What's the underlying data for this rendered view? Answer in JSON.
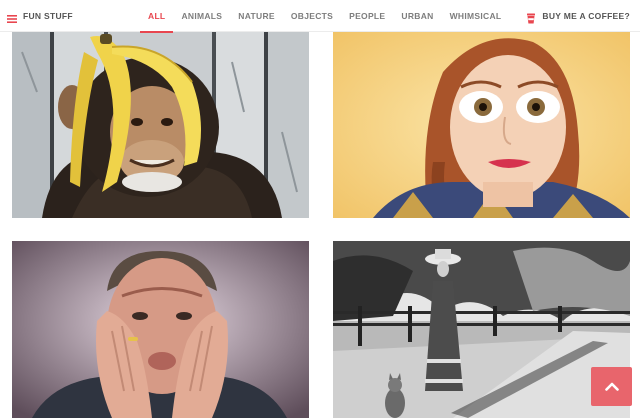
{
  "header": {
    "brand_label": "FUN STUFF",
    "tabs": [
      {
        "label": "ALL",
        "active": true
      },
      {
        "label": "ANIMALS",
        "active": false
      },
      {
        "label": "NATURE",
        "active": false
      },
      {
        "label": "OBJECTS",
        "active": false
      },
      {
        "label": "PEOPLE",
        "active": false
      },
      {
        "label": "URBAN",
        "active": false
      },
      {
        "label": "WHIMSICAL",
        "active": false
      }
    ],
    "coffee_label": "BUY ME A COFFEE?"
  },
  "icons": {
    "menu": "menu-icon",
    "coffee": "coffee-cup-icon",
    "back_to_top": "chevron-up-icon"
  },
  "colors": {
    "accent": "#e8464f",
    "back_to_top": "#e8656c"
  }
}
